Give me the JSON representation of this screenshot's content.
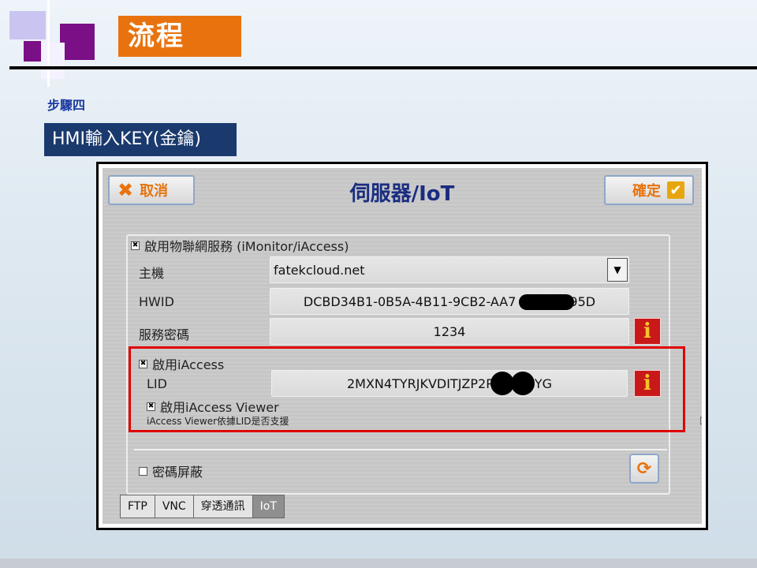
{
  "slide": {
    "title": "流程",
    "step": "步驟四",
    "subtitle": "HMI輸入KEY(金鑰)"
  },
  "hmi": {
    "header": {
      "cancel_label": "取消",
      "title": "伺服器/IoT",
      "confirm_label": "確定"
    },
    "iot_service": {
      "enable_label": "啟用物聯網服務 (iMonitor/iAccess)",
      "enabled": true,
      "host_label": "主機",
      "host_value": "fatekcloud.net",
      "hwid_label": "HWID",
      "hwid_prefix": "DCBD34B1-0B5A-4B11-9CB2-AA7",
      "hwid_suffix": "95D",
      "service_password_label": "服務密碼",
      "service_password_value": "1234"
    },
    "iaccess": {
      "enable_label": "啟用iAccess",
      "enabled": true,
      "lid_label": "LID",
      "lid_prefix": "2MXN4TYRJKVDITJZP2P",
      "lid_suffix": "YG",
      "viewer_enable_label": "啟用iAccess Viewer",
      "viewer_enabled": true,
      "viewer_note": "iAccess Viewer依據LID是否支援"
    },
    "password_mask_label": "密碼屏蔽",
    "password_mask_enabled": false,
    "info_glyph": "i",
    "tabs": [
      "FTP",
      "VNC",
      "穿透通訊",
      "IoT"
    ],
    "active_tab": "IoT"
  },
  "colors": {
    "accent_orange": "#e8730e",
    "title_navy": "#1a2d80",
    "highlight_red": "#e00000",
    "info_red": "#c81818"
  }
}
